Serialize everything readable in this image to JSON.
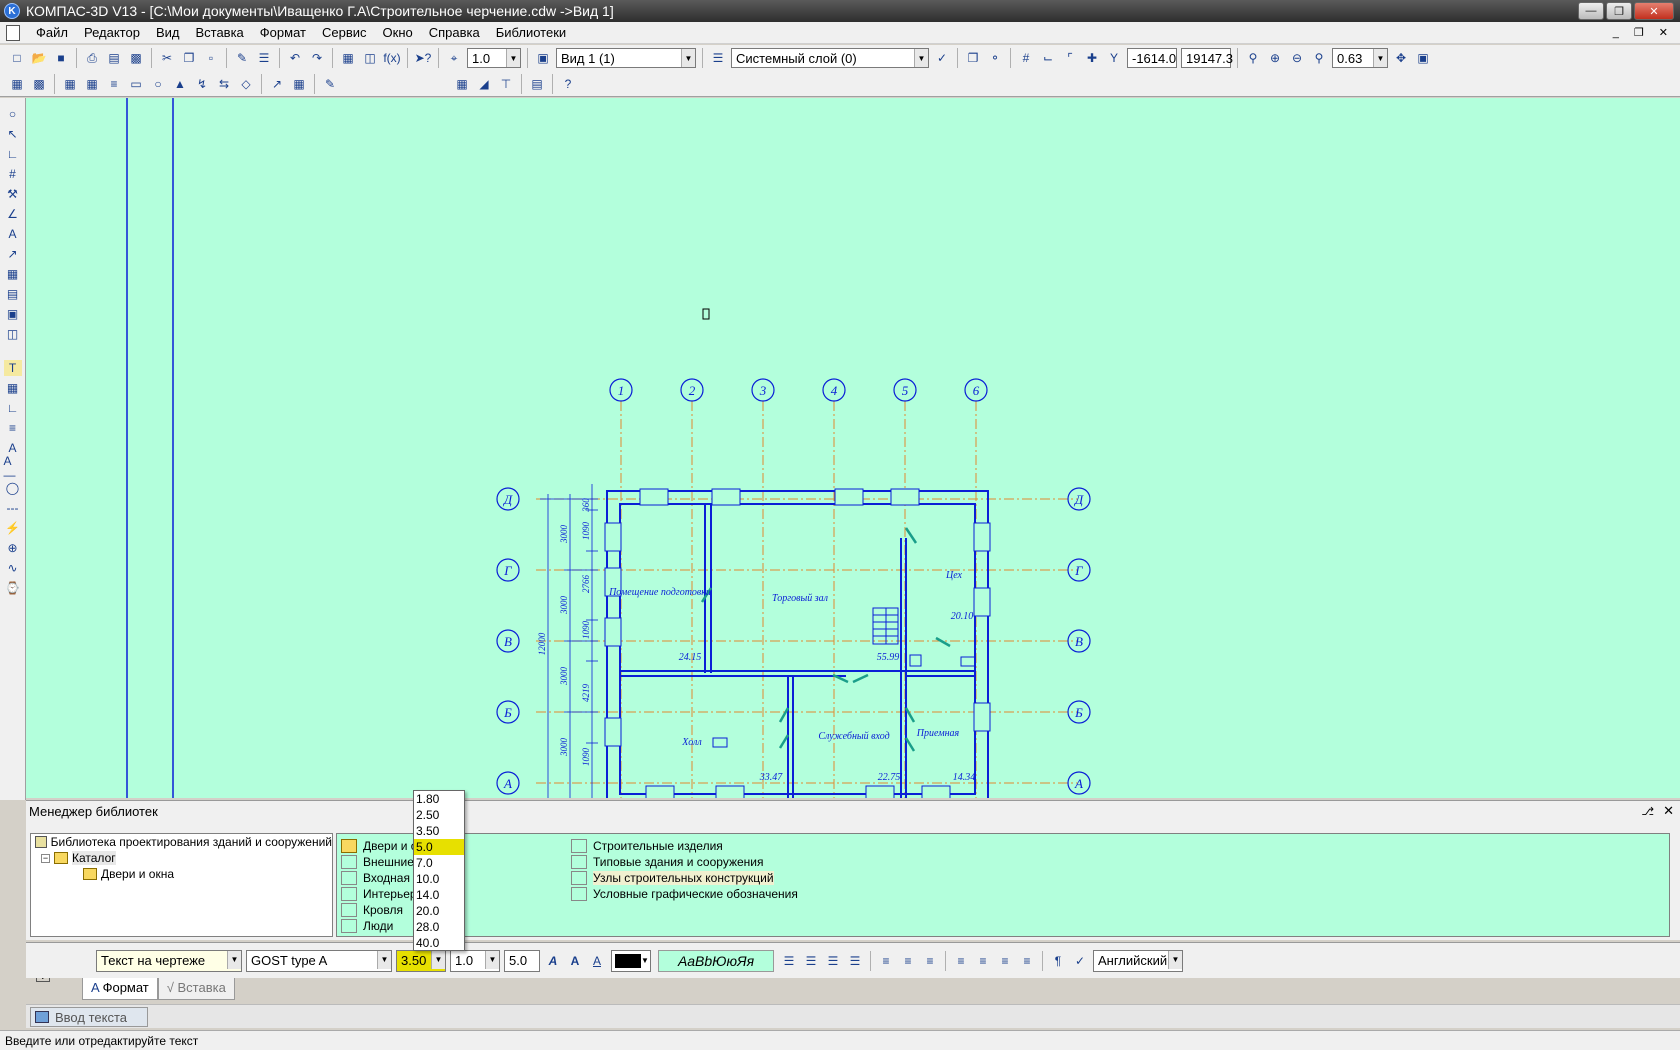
{
  "window": {
    "title": "КОМПАС-3D V13 - [C:\\Мои документы\\Иващенко Г.А\\Строительное черчение.cdw ->Вид 1]",
    "icon": "kompas-logo-icon"
  },
  "menu": [
    "Файл",
    "Редактор",
    "Вид",
    "Вставка",
    "Формат",
    "Сервис",
    "Окно",
    "Справка",
    "Библиотеки"
  ],
  "toolbar": {
    "step_value": "1.0",
    "view_value": "Вид 1 (1)",
    "layer_value": "Системный слой (0)",
    "coord_x": "-1614.0",
    "coord_y": "19147.3",
    "zoom_value": "0.63"
  },
  "drawing": {
    "axes_top": [
      "1",
      "2",
      "3",
      "4",
      "5",
      "6"
    ],
    "axes_side": [
      "Д",
      "Г",
      "В",
      "Б",
      "А"
    ],
    "overall_dimension": "12000",
    "bay_dimensions": [
      "3000",
      "3000",
      "3000",
      "3000"
    ],
    "inner_dimensions": [
      "1090",
      "2766",
      "1090",
      "4219",
      "1090",
      "360"
    ],
    "rooms": [
      {
        "name": "Помещение подготовки",
        "area": "24.15"
      },
      {
        "name": "Торговый зал",
        "area": "55.99"
      },
      {
        "name": "Цех",
        "area": "20.10"
      },
      {
        "name": "Холл",
        "area": "33.47"
      },
      {
        "name": "Служебный вход",
        "area": "22.75"
      },
      {
        "name": "Приемная",
        "area": "14.34"
      }
    ],
    "colors": {
      "background": "#b3ffdc",
      "walls": "#0a1fd6",
      "axis_lines": "#e08a30",
      "doors": "#1a9e8a"
    }
  },
  "library_manager": {
    "title": "Менеджер библиотек",
    "tree": [
      {
        "label": "Библиотека проектирования зданий и сооружений",
        "level": 0
      },
      {
        "label": "Каталог",
        "level": 1
      },
      {
        "label": "Двери и окна",
        "level": 2
      }
    ],
    "col1": [
      "Двери и окна",
      "Внешние",
      "Входная",
      "Интерьер",
      "Кровля",
      "Люди"
    ],
    "col2": [
      "Строительные изделия",
      "Типовые здания и сооружения",
      "Узлы строительных конструкций",
      "Условные графические обозначения"
    ]
  },
  "font_size_dropdown": {
    "options": [
      "1.80",
      "2.50",
      "3.50",
      "5.0",
      "7.0",
      "10.0",
      "14.0",
      "20.0",
      "28.0",
      "40.0"
    ],
    "highlighted": "5.0"
  },
  "text_props": {
    "style": "Текст на чертеже",
    "font": "GOST type A",
    "size": "3.50",
    "width_factor": "1.0",
    "step": "5.0",
    "sample": "АаВbЮюЯя",
    "language": "Английский"
  },
  "tabs": [
    "Формат",
    "Вставка"
  ],
  "task_button": "Ввод текста",
  "status": "Введите или отредактируйте текст"
}
